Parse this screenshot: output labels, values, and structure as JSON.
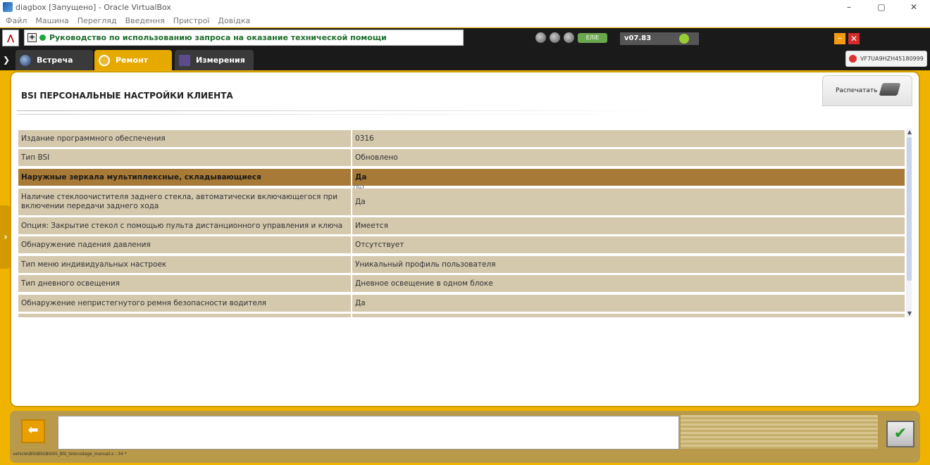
{
  "window": {
    "title": "diagbox [Запущено] - Oracle VirtualBox",
    "controls": [
      "–",
      "▢",
      "✕"
    ]
  },
  "menu": [
    "Файл",
    "Машина",
    "Перегляд",
    "Введення",
    "Пристрої",
    "Довідка"
  ],
  "appbar": {
    "message": "Руководство по использованию запроса на оказание технической помощи",
    "battery": "ЕЛІЕ",
    "version": "v07.83",
    "minimize": "–",
    "close": "✕"
  },
  "tabs": {
    "toggle": "❯",
    "meet": "Встреча",
    "repair": "Ремонт",
    "measure": "Измерения",
    "vin": "VF7UA9HZH45180999"
  },
  "page": {
    "title": "BSI  ПЕРСОНАЛЬНЫЕ НАСТРОЙКИ КЛИЕНТА",
    "print_label": "Распечатать",
    "side_handle": "›",
    "mini_tooltip": "Да"
  },
  "rows": [
    {
      "label": "Издание программного обеспечения",
      "value": "0316"
    },
    {
      "label": "Тип BSI",
      "value": "Обновлено"
    },
    {
      "label": "Наружные зеркала мультиплексные, складывающиеся",
      "value": "Да"
    },
    {
      "label": "Наличие стеклоочистителя заднего стекла, автоматически включающегося при включении передачи заднего хода",
      "value": "Да"
    },
    {
      "label": "Опция: Закрытие стекол с помощью пульта дистанционного управления и ключа",
      "value": "Имеется"
    },
    {
      "label": "Обнаружение падения давления",
      "value": "Отсутствует"
    },
    {
      "label": "Тип меню индивидуальных настроек",
      "value": "Уникальный профиль пользователя"
    },
    {
      "label": "Тип дневного освещения",
      "value": "Дневное освещение в одном блоке"
    },
    {
      "label": "Обнаружение непристегнутого ремня безопасности водителя",
      "value": "Да"
    }
  ],
  "bottom": {
    "back": "⬅",
    "ok": "✔",
    "status_path": "vehicle\\BSI\\BSI\\BSI05_BSI_telecodage_manuel.s : 34 *"
  }
}
